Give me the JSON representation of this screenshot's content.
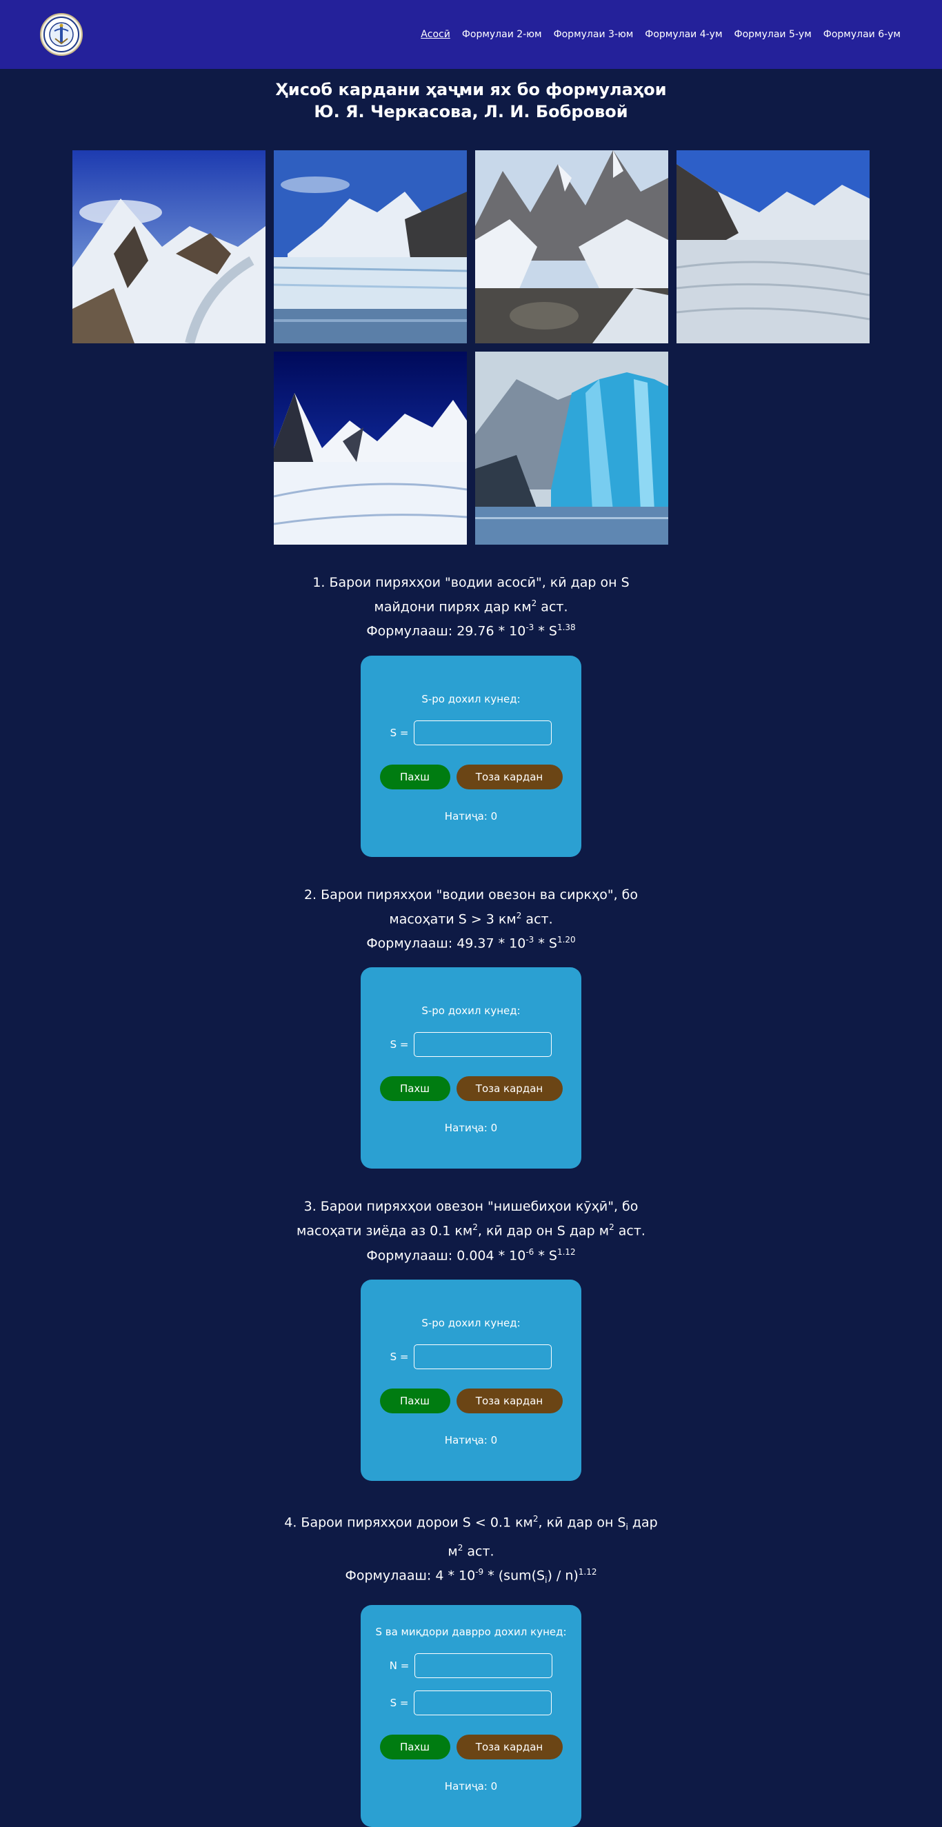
{
  "nav": {
    "logo_icon": "university-emblem-icon",
    "items": [
      "Асосӣ",
      "Формулаи 2-юм",
      "Формулаи 3-юм",
      "Формулаи 4-ум",
      "Формулаи 5-ум",
      "Формулаи 6-ум"
    ]
  },
  "header": {
    "title_line1": "Ҳисоб кардани ҳаҷми ях бо формулаҳои",
    "title_line2": "Ю. Я. Черкасова, Л. И. Бобровой"
  },
  "gallery": {
    "images": [
      "glacier-valley-image",
      "glacier-front-lake-image",
      "glacier-ice-boulders-image",
      "glacier-snowfield-image",
      "glacier-blue-sky-image",
      "glacier-blue-ice-image"
    ]
  },
  "formulas": [
    {
      "desc_line1": "1. Барои пиряхҳои \"водии асосӣ\", кӣ дар он S",
      "desc_line2": "майдони пирях дар км",
      "desc_line2_sup": "2",
      "desc_line2_end": " аст.",
      "formula_prefix": "Формулааш: 29.76 * 10",
      "formula_exp1": "-3",
      "formula_mid": " * S",
      "formula_exp2": "1.38",
      "prompt": "S-ро дохил кунед:",
      "fields": [
        {
          "label": "S ="
        }
      ],
      "calc_label": "Пахш",
      "clear_label": "Тоза кардан",
      "result": "Натиҷа: 0"
    },
    {
      "desc_line1": "2. Барои пиряхҳои \"водии овезон ва сиркҳо\", бо",
      "desc_line2": "масоҳати S > 3 км",
      "desc_line2_sup": "2",
      "desc_line2_end": " аст.",
      "formula_prefix": "Формулааш: 49.37 * 10",
      "formula_exp1": "-3",
      "formula_mid": " * S",
      "formula_exp2": "1.20",
      "prompt": "S-ро дохил кунед:",
      "fields": [
        {
          "label": "S ="
        }
      ],
      "calc_label": "Пахш",
      "clear_label": "Тоза кардан",
      "result": "Натиҷа: 0"
    },
    {
      "desc_line1": "3. Барои пиряхҳои овезон \"нишебиҳои кӯҳӣ\", бо",
      "desc_line2": "масоҳати зиёда аз 0.1 км",
      "desc_line2_sup": "2",
      "desc_line2_end": ", кӣ дар он S дар м",
      "desc_line2_sup2": "2",
      "desc_line2_end2": " аст.",
      "formula_prefix": "Формулааш: 0.004 * 10",
      "formula_exp1": "-6",
      "formula_mid": " * S",
      "formula_exp2": "1.12",
      "prompt": "S-ро дохил кунед:",
      "fields": [
        {
          "label": "S ="
        }
      ],
      "calc_label": "Пахш",
      "clear_label": "Тоза кардан",
      "result": "Натиҷа: 0"
    },
    {
      "desc_line1a": "4. Барои пиряхҳои дорои S < 0.1 км",
      "desc_line1_sup": "2",
      "desc_line1b": ", кӣ дар он S",
      "desc_line1_sub": "i",
      "desc_line1c": " дар",
      "desc_line2": "м",
      "desc_line2_sup": "2",
      "desc_line2_end": " аст.",
      "formula_prefix": "Формулааш: 4 * 10",
      "formula_exp1": "-9",
      "formula_mid": " * (sum(S",
      "formula_sub": "i",
      "formula_mid2": ") / n)",
      "formula_exp2": "1.12",
      "prompt": "S ва миқдори даврро дохил кунед:",
      "fields": [
        {
          "label": "N ="
        },
        {
          "label": "S ="
        }
      ],
      "calc_label": "Пахш",
      "clear_label": "Тоза кардан",
      "result": "Натиҷа: 0"
    }
  ],
  "colors": {
    "page_bg": "#0e1a45",
    "navbar_bg": "#24219a",
    "calc_card_bg": "#2ba0d2",
    "calc_button": "#007c11",
    "clear_button": "#6b4515"
  }
}
